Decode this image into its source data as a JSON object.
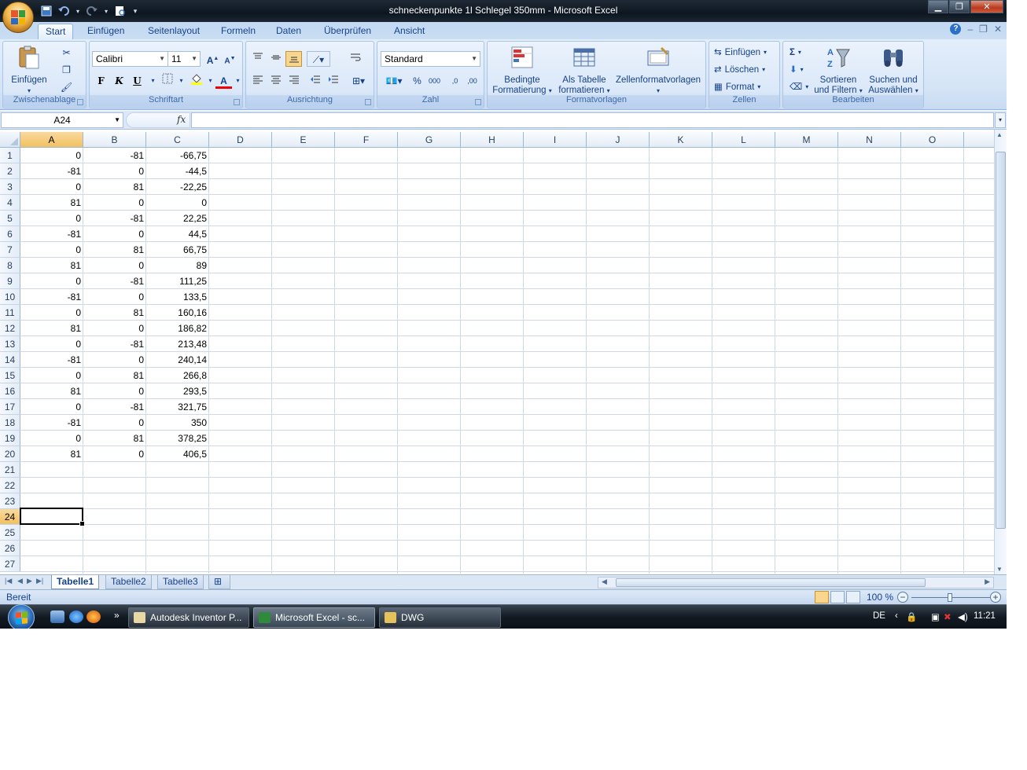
{
  "window": {
    "title": "schneckenpunkte 1l Schlegel 350mm - Microsoft Excel",
    "controls": [
      "minimize-icon",
      "maximize-icon",
      "close-icon"
    ]
  },
  "quick_access": {
    "items": [
      "save-icon",
      "undo-icon",
      "redo-icon",
      "print-preview-icon",
      "customize-icon"
    ]
  },
  "ribbon": {
    "tabs": [
      "Start",
      "Einfügen",
      "Seitenlayout",
      "Formeln",
      "Daten",
      "Überprüfen",
      "Ansicht"
    ],
    "active_tab": "Start",
    "groups": {
      "clipboard": {
        "label": "Zwischenablage",
        "paste": "Einfügen"
      },
      "font": {
        "label": "Schriftart",
        "font_name": "Calibri",
        "font_size": "11",
        "bold": "F",
        "italic": "K",
        "underline": "U",
        "grow": "A",
        "shrink": "A",
        "font_color_letter": "A"
      },
      "alignment": {
        "label": "Ausrichtung"
      },
      "number": {
        "label": "Zahl",
        "format": "Standard",
        "percent": "%",
        "thousands": "000",
        "inc_dec": ",0",
        "dec_dec": ",00"
      },
      "styles": {
        "label": "Formatvorlagen",
        "conditional_line1": "Bedingte",
        "conditional_line2": "Formatierung",
        "table_line1": "Als Tabelle",
        "table_line2": "formatieren",
        "cellstyles": "Zellenformatvorlagen"
      },
      "cells": {
        "label": "Zellen",
        "insert": "Einfügen",
        "delete": "Löschen",
        "format": "Format"
      },
      "editing": {
        "label": "Bearbeiten",
        "sum": "Σ",
        "sort_line1": "Sortieren",
        "sort_line2": "und Filtern",
        "find_line1": "Suchen und",
        "find_line2": "Auswählen"
      }
    }
  },
  "formula_bar": {
    "name_box": "A24",
    "fx": "fx",
    "formula": ""
  },
  "sheet": {
    "columns": [
      "A",
      "B",
      "C",
      "D",
      "E",
      "F",
      "G",
      "H",
      "I",
      "J",
      "K",
      "L",
      "M",
      "N",
      "O"
    ],
    "selected_column": "A",
    "row_numbers": [
      "1",
      "2",
      "3",
      "4",
      "5",
      "6",
      "7",
      "8",
      "9",
      "10",
      "11",
      "12",
      "13",
      "14",
      "15",
      "16",
      "17",
      "18",
      "19",
      "20",
      "21",
      "22",
      "23",
      "24",
      "25",
      "26",
      "27"
    ],
    "selected_row": "24",
    "selected_cell": "A24",
    "data": [
      [
        "0",
        "-81",
        "-66,75"
      ],
      [
        "-81",
        "0",
        "-44,5"
      ],
      [
        "0",
        "81",
        "-22,25"
      ],
      [
        "81",
        "0",
        "0"
      ],
      [
        "0",
        "-81",
        "22,25"
      ],
      [
        "-81",
        "0",
        "44,5"
      ],
      [
        "0",
        "81",
        "66,75"
      ],
      [
        "81",
        "0",
        "89"
      ],
      [
        "0",
        "-81",
        "111,25"
      ],
      [
        "-81",
        "0",
        "133,5"
      ],
      [
        "0",
        "81",
        "160,16"
      ],
      [
        "81",
        "0",
        "186,82"
      ],
      [
        "0",
        "-81",
        "213,48"
      ],
      [
        "-81",
        "0",
        "240,14"
      ],
      [
        "0",
        "81",
        "266,8"
      ],
      [
        "81",
        "0",
        "293,5"
      ],
      [
        "0",
        "-81",
        "321,75"
      ],
      [
        "-81",
        "0",
        "350"
      ],
      [
        "0",
        "81",
        "378,25"
      ],
      [
        "81",
        "0",
        "406,5"
      ]
    ]
  },
  "sheet_tabs": {
    "tabs": [
      "Tabelle1",
      "Tabelle2",
      "Tabelle3"
    ],
    "active": "Tabelle1"
  },
  "status_bar": {
    "status": "Bereit",
    "zoom": "100 %"
  },
  "taskbar": {
    "buttons": [
      {
        "label": "Autodesk Inventor P...",
        "active": false
      },
      {
        "label": "Microsoft Excel - sc...",
        "active": true
      },
      {
        "label": "DWG",
        "active": false
      }
    ],
    "language": "DE",
    "time": "11:21"
  },
  "colors": {
    "ribbon_text": "#15428b",
    "selected_header": "#f1c15f",
    "grid_line": "#d0d7e5",
    "title_bar": "#0d1620"
  }
}
